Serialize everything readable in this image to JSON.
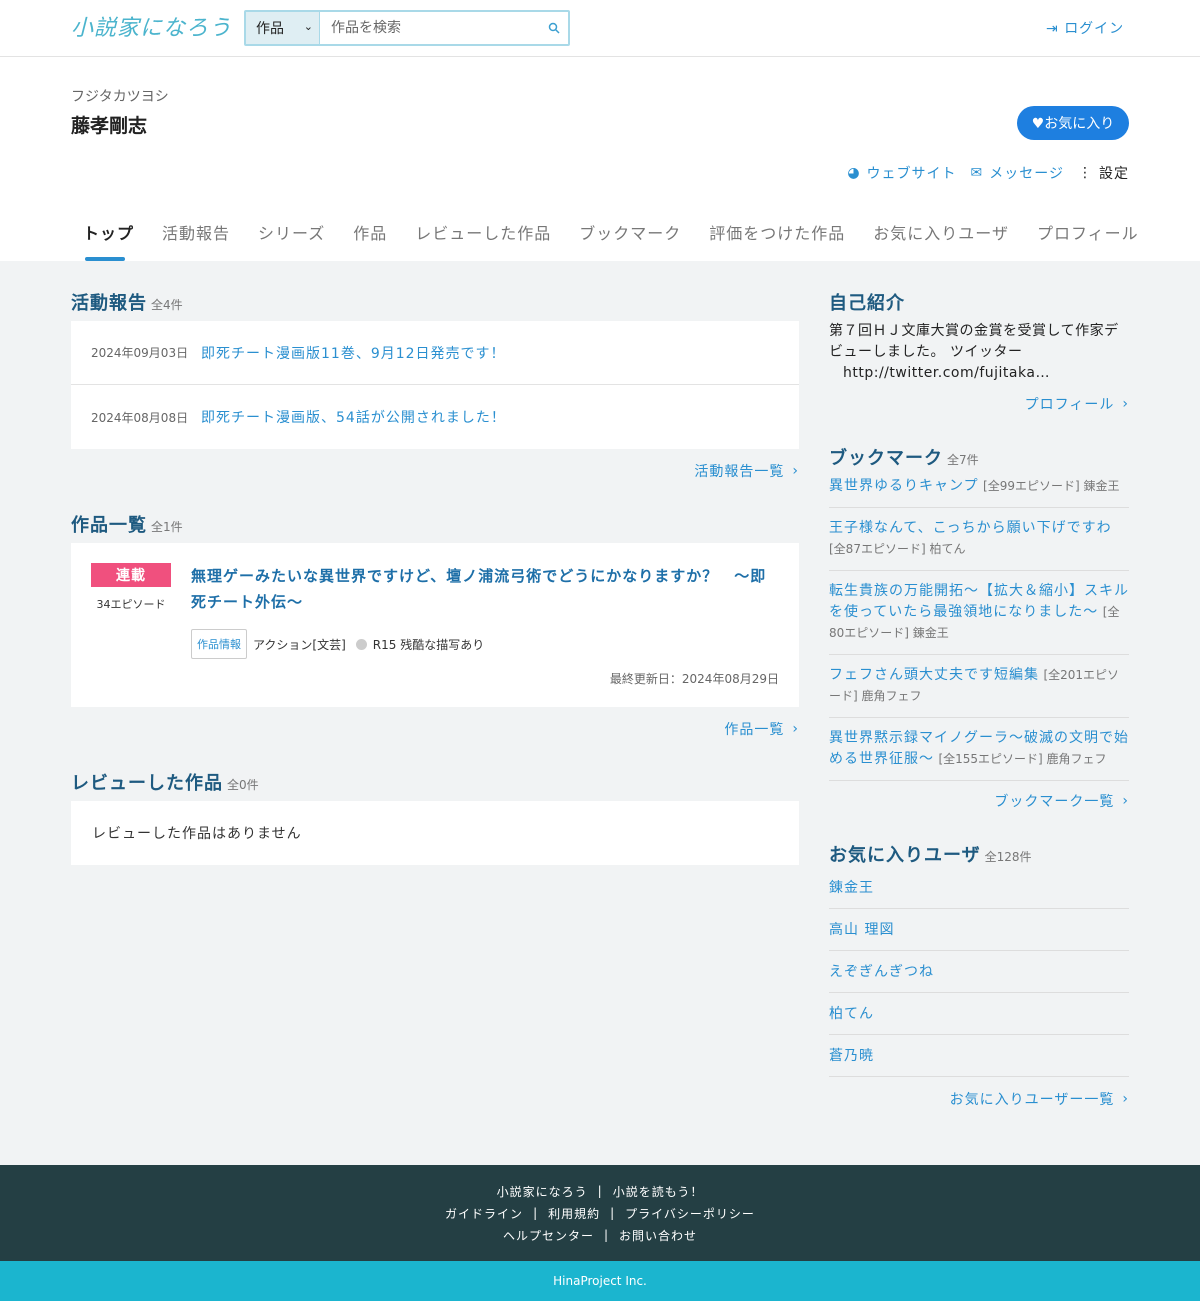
{
  "header": {
    "logo": "小説家になろう",
    "search": {
      "select_value": "作品",
      "placeholder": "作品を検索"
    },
    "login_label": "ログイン"
  },
  "profile": {
    "kana": "フジタカツヨシ",
    "name": "藤孝剛志",
    "favorite_label": "♥お気に入り",
    "actions": {
      "website": "ウェブサイト",
      "message": "メッセージ",
      "settings": "設定"
    }
  },
  "tabs": [
    "トップ",
    "活動報告",
    "シリーズ",
    "作品",
    "レビューした作品",
    "ブックマーク",
    "評価をつけた作品",
    "お気に入りユーザ",
    "プロフィール"
  ],
  "reports": {
    "title": "活動報告",
    "count": "全4件",
    "items": [
      {
        "date": "2024年09月03日",
        "text": "即死チート漫画版11巻、9月12日発売です！"
      },
      {
        "date": "2024年08月08日",
        "text": "即死チート漫画版、54話が公開されました！"
      }
    ],
    "more": "活動報告一覧"
  },
  "works": {
    "title": "作品一覧",
    "count": "全1件",
    "item": {
      "badge": "連載",
      "episodes": "34エピソード",
      "title": "無理ゲーみたいな異世界ですけど、壇ノ浦流弓術でどうにかなりますか？　〜即死チート外伝〜",
      "tag_box": "作品情報",
      "genre": "アクション[文芸]",
      "rating": "R15 残酷な描写あり",
      "updated": "最終更新日：2024年08月29日"
    },
    "more": "作品一覧"
  },
  "reviews": {
    "title": "レビューした作品",
    "count": "全0件",
    "empty": "レビューした作品はありません"
  },
  "intro": {
    "title": "自己紹介",
    "text1": "第７回ＨＪ文庫大賞の金賞を受賞して作家デビューしました。 ツイッター",
    "text2": "http://twitter.com/fujitaka…",
    "more": "プロフィール"
  },
  "bookmarks": {
    "title": "ブックマーク",
    "count": "全7件",
    "items": [
      {
        "title": "異世界ゆるりキャンプ",
        "meta": "[全99エピソード] 錬金王"
      },
      {
        "title": "王子様なんて、こっちから願い下げですわ",
        "meta": "[全87エピソード] 柏てん"
      },
      {
        "title": "転生貴族の万能開拓〜【拡大＆縮小】スキルを使っていたら最強領地になりました〜",
        "meta": "[全80エピソード] 錬金王"
      },
      {
        "title": "フェフさん頭大丈夫です短編集",
        "meta": "[全201エピソード] 鹿角フェフ"
      },
      {
        "title": "異世界黙示録マイノグーラ〜破滅の文明で始める世界征服〜",
        "meta": "[全155エピソード] 鹿角フェフ"
      }
    ],
    "more": "ブックマーク一覧"
  },
  "fav_users": {
    "title": "お気に入りユーザ",
    "count": "全128件",
    "items": [
      "錬金王",
      "高山 理図",
      "えぞぎんぎつね",
      "柏てん",
      "蒼乃暁"
    ],
    "more": "お気に入りユーザー一覧"
  },
  "footer": {
    "links1": [
      "小説家になろう",
      "小説を読もう！"
    ],
    "links2": [
      "ガイドライン",
      "利用規約",
      "プライバシーポリシー"
    ],
    "links3": [
      "ヘルプセンター",
      "お問い合わせ"
    ],
    "copyright": "HinaProject Inc."
  },
  "colors": {
    "accent": "#2a8fd0",
    "favorite_button": "#1e7fe0",
    "serial_badge": "#f0507e",
    "footer_bg": "#243f44",
    "copyright_bg": "#1bb5cf"
  }
}
